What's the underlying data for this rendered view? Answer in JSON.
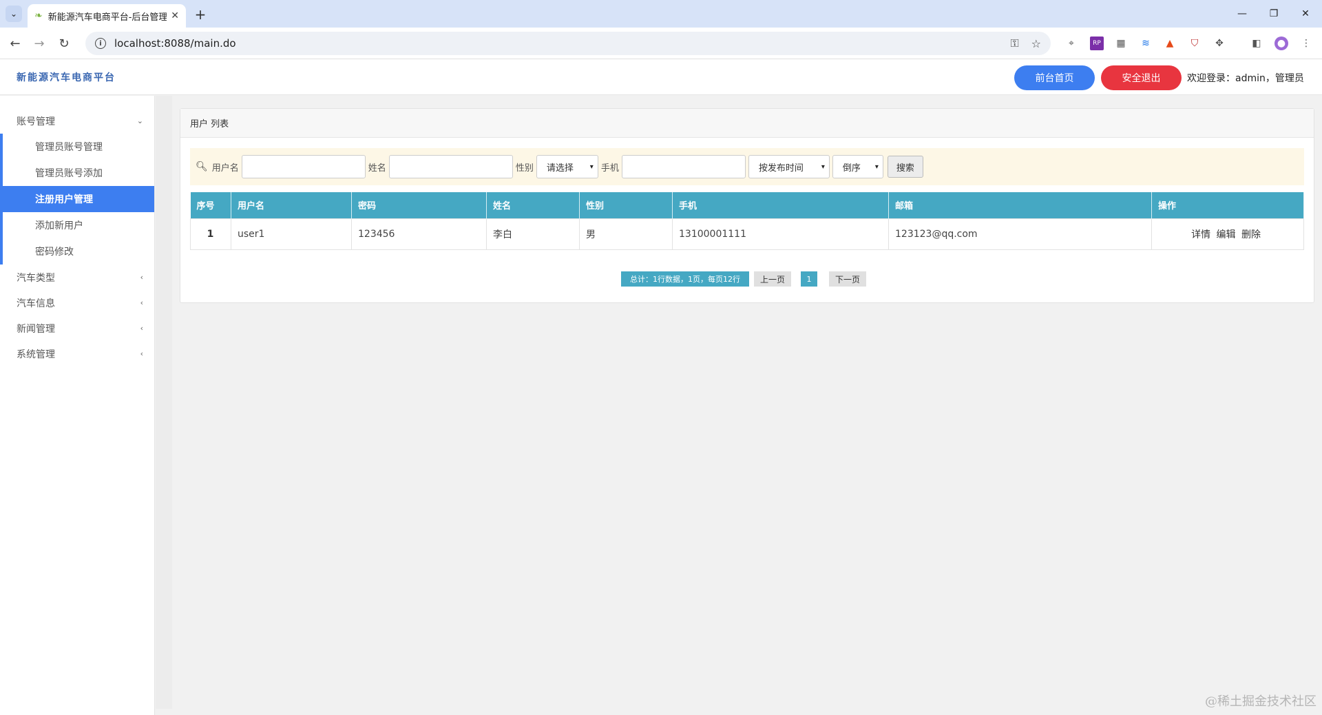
{
  "browser": {
    "tab_title": "新能源汽车电商平台-后台管理",
    "url": "localhost:8088/main.do"
  },
  "header": {
    "brand": "新能源汽车电商平台",
    "home_button": "前台首页",
    "logout_button": "安全退出",
    "welcome": "欢迎登录：admin，管理员"
  },
  "sidebar": {
    "groups": [
      {
        "label": "账号管理",
        "expanded": true,
        "items": [
          "管理员账号管理",
          "管理员账号添加",
          "注册用户管理",
          "添加新用户",
          "密码修改"
        ],
        "active_index": 2
      },
      {
        "label": "汽车类型",
        "expanded": false
      },
      {
        "label": "汽车信息",
        "expanded": false
      },
      {
        "label": "新闻管理",
        "expanded": false
      },
      {
        "label": "系统管理",
        "expanded": false
      }
    ]
  },
  "panel": {
    "title": "用户 列表",
    "search": {
      "username_label": "用户名",
      "name_label": "姓名",
      "gender_label": "性别",
      "gender_selected": "请选择",
      "phone_label": "手机",
      "sort_field": "按发布时间",
      "sort_order": "倒序",
      "search_button": "搜索"
    },
    "table": {
      "headers": [
        "序号",
        "用户名",
        "密码",
        "姓名",
        "性别",
        "手机",
        "邮箱",
        "操作"
      ],
      "rows": [
        {
          "index": "1",
          "username": "user1",
          "password": "123456",
          "name": "李白",
          "gender": "男",
          "phone": "13100001111",
          "email": "123123@qq.com"
        }
      ],
      "ops": [
        "详情",
        "编辑",
        "删除"
      ]
    },
    "pager": {
      "total": "总计：1行数据，1页，每页12行",
      "prev": "上一页",
      "current": "1",
      "next": "下一页"
    }
  },
  "watermark": "@稀土掘金技术社区"
}
